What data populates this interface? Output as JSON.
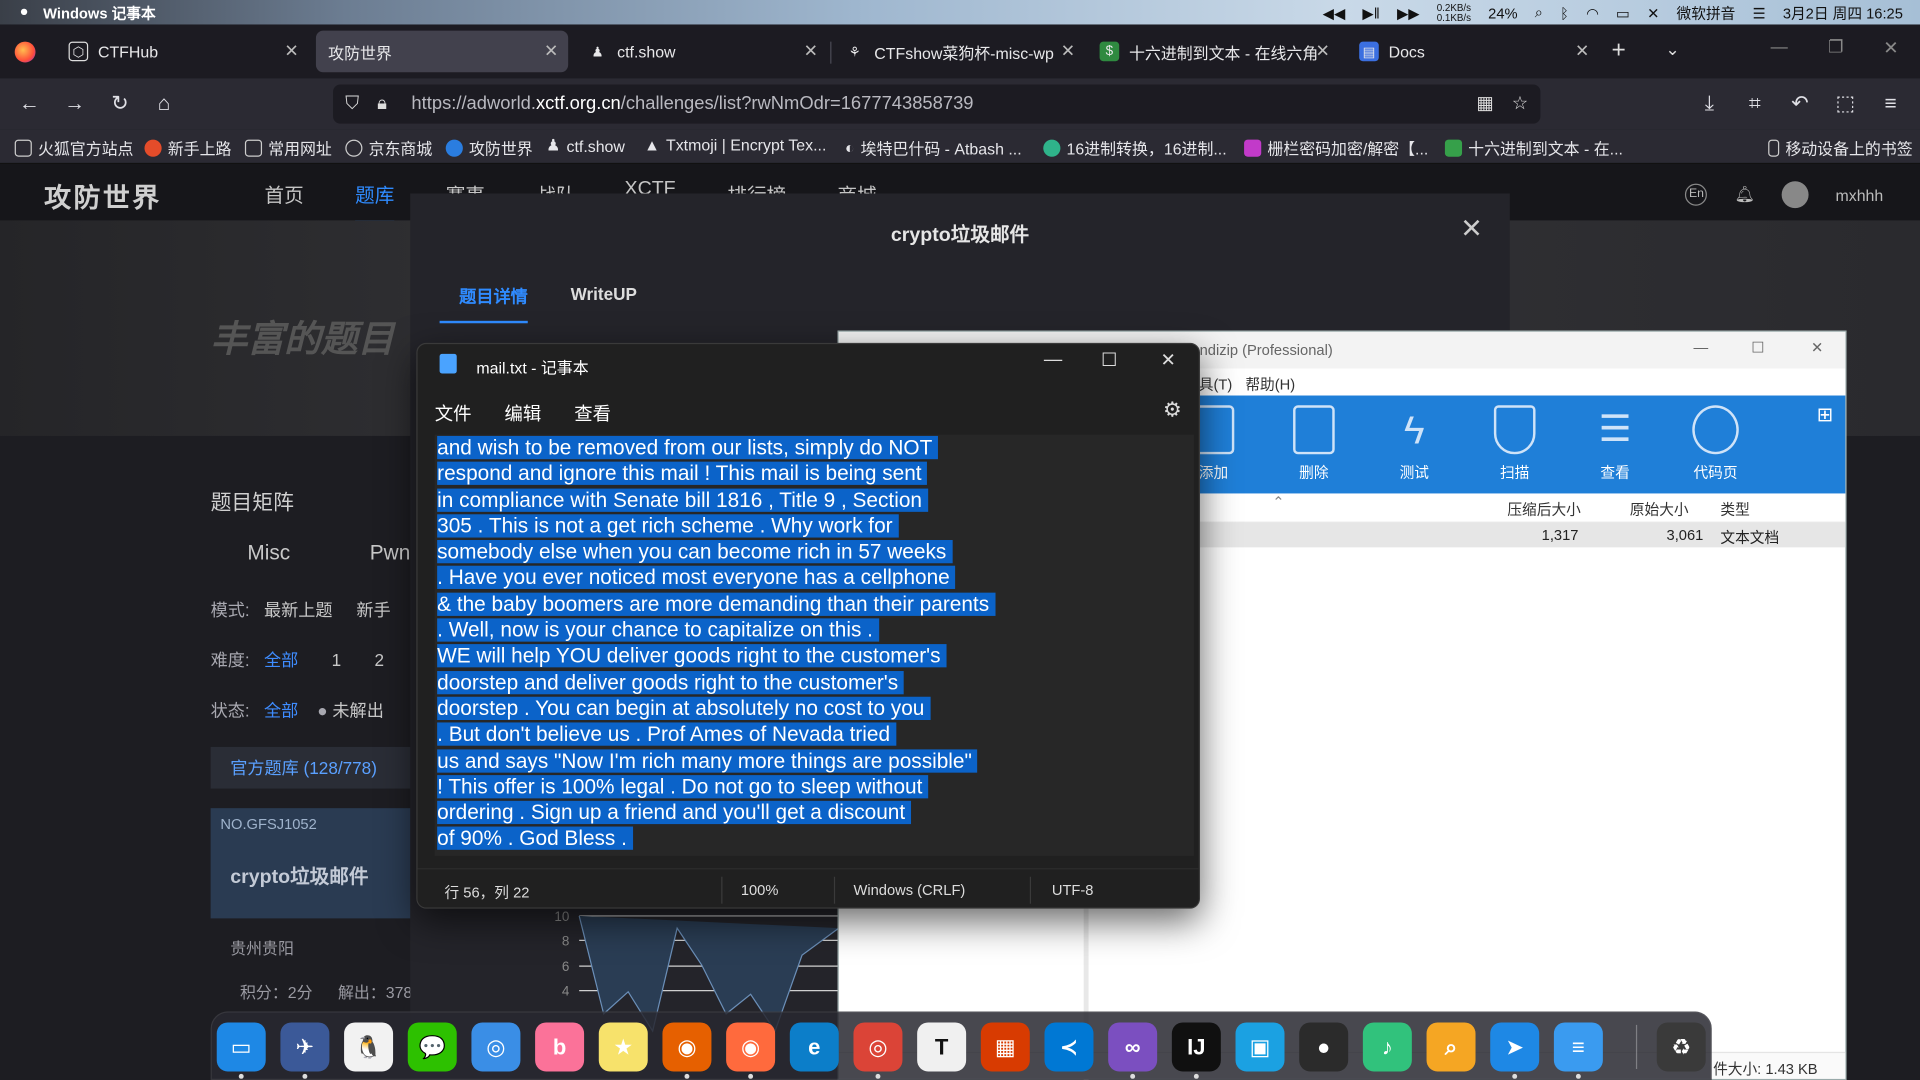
{
  "menubar": {
    "app_name": "Windows 记事本",
    "net_up": "0.2KB/s",
    "net_down": "0.1KB/s",
    "battery": "24%",
    "ime": "微软拼音",
    "datetime": "3月2日 周四 16:25"
  },
  "tabs": [
    {
      "label": "CTFHub",
      "active": false
    },
    {
      "label": "攻防世界",
      "active": true
    },
    {
      "label": "ctf.show",
      "active": false
    },
    {
      "label": "CTFshow菜狗杯-misc-wp",
      "active": false
    },
    {
      "label": "十六进制到文本 - 在线六角",
      "active": false
    },
    {
      "label": "Docs",
      "active": false
    }
  ],
  "url": {
    "prefix": "https://adworld.",
    "host": "xctf.org.cn",
    "rest": "/challenges/list?rwNmOdr=1677743858739"
  },
  "bookmarks": [
    {
      "label": "火狐官方站点",
      "color": "#00000000"
    },
    {
      "label": "新手上路",
      "color": "#e44c2a"
    },
    {
      "label": "常用网址",
      "color": "#00000000"
    },
    {
      "label": "京东商城",
      "color": "#00000000"
    },
    {
      "label": "攻防世界",
      "color": "#2a7de0"
    },
    {
      "label": "ctf.show",
      "color": "#00000000"
    },
    {
      "label": "Txtmoji | Encrypt Tex...",
      "color": "#ffffff"
    },
    {
      "label": "埃特巴什码 - Atbash ...",
      "color": "#00000000"
    },
    {
      "label": "16进制转换，16进制...",
      "color": "#2fb38a"
    },
    {
      "label": "栅栏密码加密/解密【...",
      "color": "#c23ac9"
    },
    {
      "label": "十六进制到文本 - 在...",
      "color": "#36a04a"
    },
    {
      "label": "移动设备上的书签",
      "color": "#00000000"
    }
  ],
  "site": {
    "logo": "攻防世界",
    "nav": [
      "首页",
      "题库",
      "赛事",
      "战队",
      "XCTF",
      "排行榜",
      "商城"
    ],
    "nav_active": "题库",
    "user": "mxhhh",
    "lang": "En",
    "banner_text": "丰富的题目",
    "matrix_title": "题目矩阵",
    "cat_tabs": [
      "Misc",
      "Pwn"
    ],
    "mode_label": "模式:",
    "mode_values": [
      "最新上题",
      "新手"
    ],
    "difficulty_label": "难度:",
    "difficulty_values": [
      "全部",
      "1",
      "2"
    ],
    "status_label": "状态:",
    "status_values": [
      "全部",
      "未解出"
    ],
    "official": "官方题库 (128/778)",
    "card_no": "NO.GFSJ1052",
    "card_title": "crypto垃圾邮件",
    "card_source": "贵州贵阳",
    "card_points": "积分：2分",
    "card_solves": "解出：378"
  },
  "challenge_modal": {
    "title": "crypto垃圾邮件",
    "tab_detail": "题目详情",
    "tab_writeup": "WriteUP",
    "chart_ticks": [
      "10",
      "8",
      "6",
      "4"
    ]
  },
  "bandizip": {
    "title": "andizip (Professional)",
    "menu": [
      "具(T)",
      "帮助(H)"
    ],
    "tools": [
      "添加",
      "删除",
      "测试",
      "扫描",
      "查看",
      "代码页"
    ],
    "columns": [
      "压缩后大小",
      "原始大小",
      "类型"
    ],
    "row": {
      "compressed": "1,317",
      "original": "3,061",
      "type": "文本文档"
    },
    "status": "件大小: 1.43 KB"
  },
  "notepad": {
    "title": "mail.txt - 记事本",
    "menu": [
      "文件",
      "编辑",
      "查看"
    ],
    "lines": [
      "and wish to be removed from our lists, simply do NOT ",
      "respond and ignore this mail ! This mail is being sent ",
      "in compliance with Senate bill 1816 , Title 9 , Section ",
      "305 . This is not a get rich scheme . Why work for ",
      "somebody else when you can become rich in 57 weeks ",
      ". Have you ever noticed most everyone has a cellphone ",
      "& the baby boomers are more demanding than their parents ",
      ". Well, now is your chance to capitalize on this . ",
      "WE will help YOU deliver goods right to the customer's ",
      "doorstep and deliver goods right to the customer's ",
      "doorstep . You can begin at absolutely no cost to you ",
      ". But don't believe us . Prof Ames of Nevada tried ",
      "us and says \"Now I'm rich many more things are possible\" ",
      "! This offer is 100% legal . Do not go to sleep without ",
      "ordering . Sign up a friend and you'll get a discount ",
      "of 90% . God Bless . "
    ],
    "status": {
      "position": "行 56，列 22",
      "zoom": "100%",
      "eol": "Windows (CRLF)",
      "encoding": "UTF-8"
    }
  },
  "dock": [
    {
      "name": "desktop",
      "color": "#1e88e5",
      "glyph": "▭"
    },
    {
      "name": "launchpad",
      "color": "#3b5998",
      "glyph": "✈"
    },
    {
      "name": "qq",
      "color": "#f2f2f2",
      "glyph": "🐧"
    },
    {
      "name": "wechat",
      "color": "#2dc100",
      "glyph": "💬"
    },
    {
      "name": "chat",
      "color": "#3a8ee6",
      "glyph": "◎"
    },
    {
      "name": "bilibili",
      "color": "#fb7299",
      "glyph": "b"
    },
    {
      "name": "stickies",
      "color": "#f7e26b",
      "glyph": "★"
    },
    {
      "name": "firefox",
      "color": "#e66000",
      "glyph": "◉"
    },
    {
      "name": "firefox-dev",
      "color": "#ff6a3d",
      "glyph": "◉"
    },
    {
      "name": "edge",
      "color": "#0c7ec9",
      "glyph": "e"
    },
    {
      "name": "chrome",
      "color": "#db4437",
      "glyph": "◎"
    },
    {
      "name": "typora",
      "color": "#f0f0f0",
      "glyph": "T"
    },
    {
      "name": "office",
      "color": "#d83b01",
      "glyph": "▦"
    },
    {
      "name": "vscode",
      "color": "#0078d4",
      "glyph": "≺"
    },
    {
      "name": "visual-studio",
      "color": "#7b4fc0",
      "glyph": "∞"
    },
    {
      "name": "intellij",
      "color": "#101010",
      "glyph": "IJ"
    },
    {
      "name": "box",
      "color": "#1ba1e2",
      "glyph": "▣"
    },
    {
      "name": "obs",
      "color": "#2b2b2b",
      "glyph": "●"
    },
    {
      "name": "music",
      "color": "#31c27c",
      "glyph": "♪"
    },
    {
      "name": "search",
      "color": "#f5a623",
      "glyph": "⌕"
    },
    {
      "name": "feishu",
      "color": "#1e88e5",
      "glyph": "➤"
    },
    {
      "name": "notepad",
      "color": "#3a9bf0",
      "glyph": "≡"
    },
    {
      "name": "recycle-bin",
      "color": "#3a3a3a",
      "glyph": "♻"
    }
  ]
}
